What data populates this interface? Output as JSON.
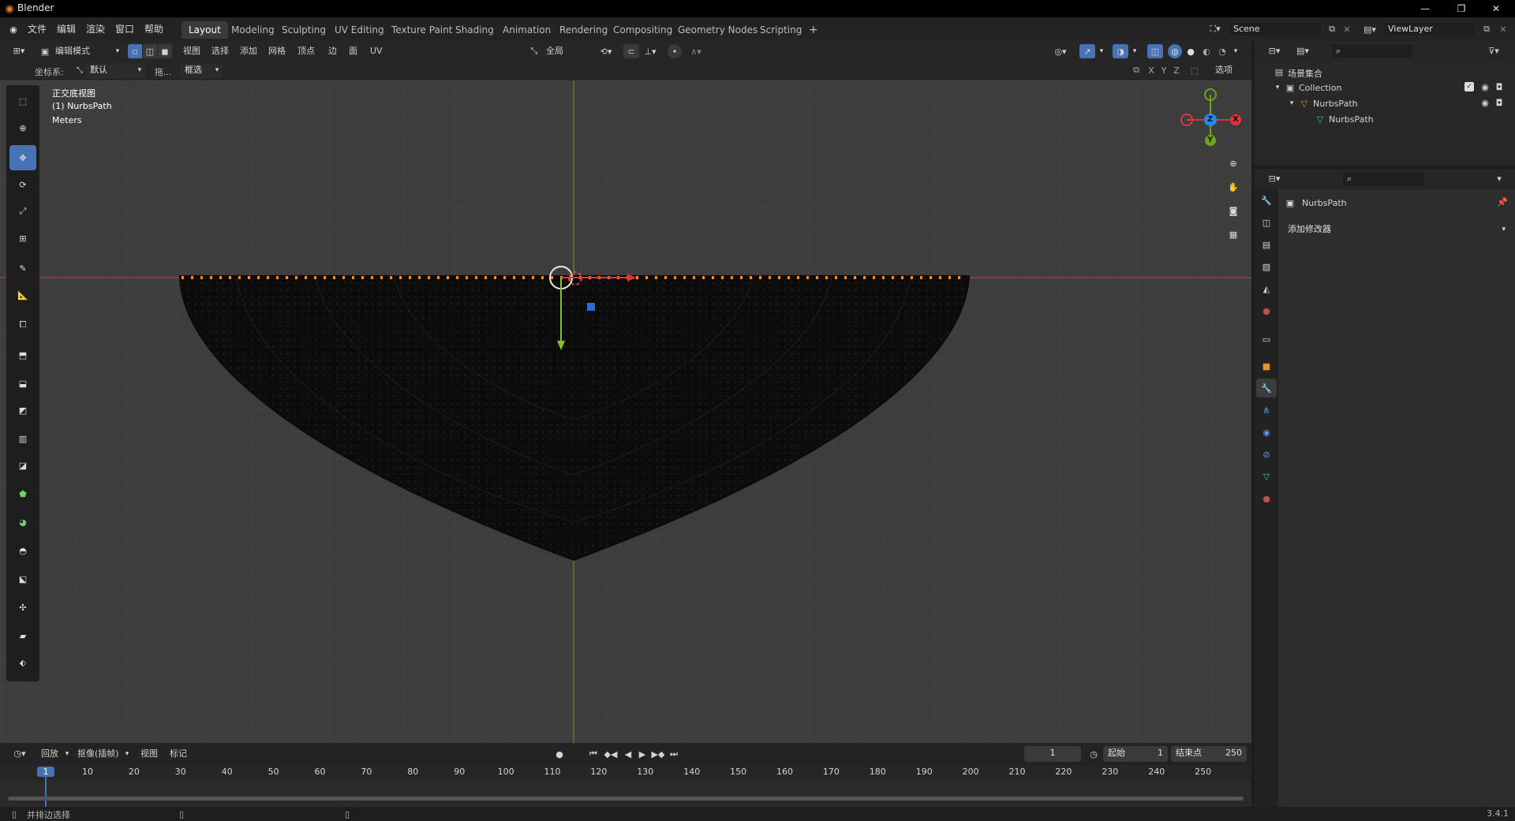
{
  "window": {
    "title": "Blender"
  },
  "menubar": {
    "menus": [
      "文件",
      "编辑",
      "渲染",
      "窗口",
      "帮助"
    ],
    "workspaces": [
      "Layout",
      "Modeling",
      "Sculpting",
      "UV Editing",
      "Texture Paint",
      "Shading",
      "Animation",
      "Rendering",
      "Compositing",
      "Geometry Nodes",
      "Scripting"
    ],
    "add_tab": "+",
    "scene": "Scene",
    "view_layer": "ViewLayer"
  },
  "viewport_header": {
    "mode": "编辑模式",
    "menus": [
      "视图",
      "选择",
      "添加",
      "网格",
      "顶点",
      "边",
      "面",
      "UV"
    ],
    "transform_orientation": "全局"
  },
  "tool_header": {
    "coord_label": "坐标系:",
    "coord_value": "默认",
    "drag_label": "拖...",
    "select_mode": "框选",
    "axes": [
      "X",
      "Y",
      "Z"
    ],
    "options": "选项"
  },
  "overlay": {
    "view_name": "正交底视图",
    "object_name": "(1) NurbsPath",
    "units": "Meters"
  },
  "gizmo": {
    "x": "X",
    "y": "Y",
    "z": "Z"
  },
  "outliner": {
    "root": "场景集合",
    "collection": "Collection",
    "object": "NurbsPath",
    "data": "NurbsPath"
  },
  "properties": {
    "object_name": "NurbsPath",
    "add_modifier": "添加修改器"
  },
  "timeline": {
    "playback": "回放",
    "keying": "抠像(插帧)",
    "view": "视图",
    "marker": "标记",
    "current_frame": "1",
    "start_label": "起始",
    "start_value": "1",
    "end_label": "结束点",
    "end_value": "250",
    "ruler": [
      "1",
      "10",
      "20",
      "30",
      "40",
      "50",
      "60",
      "70",
      "80",
      "90",
      "100",
      "110",
      "120",
      "130",
      "140",
      "150",
      "160",
      "170",
      "180",
      "190",
      "200",
      "210",
      "220",
      "230",
      "240",
      "250"
    ]
  },
  "status": {
    "hint": "并排边选择",
    "version": "3.4.1"
  },
  "colors": {
    "accent": "#4772b3",
    "x_axis": "#e0343f",
    "y_axis": "#6ea31c",
    "z_axis": "#2b89e6",
    "selection": "#ff8c1a"
  }
}
